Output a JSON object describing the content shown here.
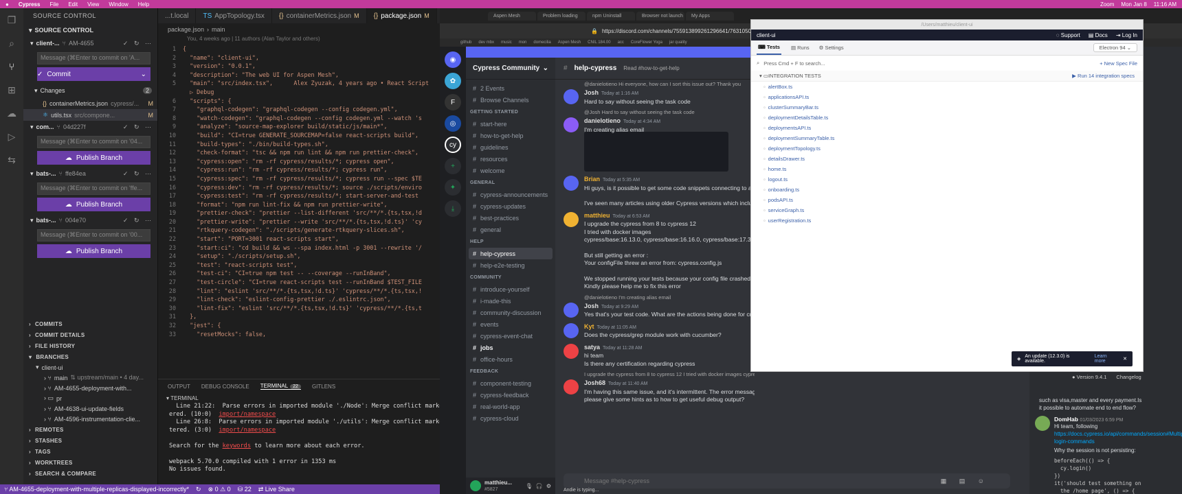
{
  "menubar": {
    "app": "Cypress",
    "items": [
      "File",
      "Edit",
      "View",
      "Window",
      "Help"
    ],
    "right_items": [
      "Zoom",
      "Mon Jan 8",
      "11:16 AM"
    ]
  },
  "vscode": {
    "title": "package.json — client-ui",
    "scm": {
      "header": "SOURCE CONTROL",
      "section": "SOURCE CONTROL",
      "repos": [
        {
          "name": "client-...",
          "branch": "AM-4655",
          "message_placeholder": "Message (⌘Enter to commit on 'A...",
          "button": "Commit"
        },
        {
          "name": "com...",
          "branch": "04d227f",
          "message_placeholder": "Message (⌘Enter to commit on '04...",
          "button": "Publish Branch"
        },
        {
          "name": "bats-...",
          "branch": "ffe84ea",
          "message_placeholder": "Message (⌘Enter to commit on 'ffe...",
          "button": "Publish Branch"
        },
        {
          "name": "bats-...",
          "branch": "004e70",
          "message_placeholder": "Message (⌘Enter to commit on '00...",
          "button": "Publish Branch"
        }
      ],
      "changes_label": "Changes",
      "changes_count": "2",
      "changed_files": [
        {
          "name": "containerMetrics.json",
          "path": "cypress/...",
          "status": "M"
        },
        {
          "name": "utils.tsx",
          "path": "src/compone...",
          "status": "M"
        }
      ],
      "bottom_sections": [
        "COMMITS",
        "COMMIT DETAILS",
        "FILE HISTORY",
        "BRANCHES"
      ],
      "branches_root": "client-ui",
      "branches": [
        {
          "name": "main",
          "info": "⇅ upstream/main • 4 day..."
        },
        {
          "name": "AM-4655-deployment-with...",
          "info": ""
        },
        {
          "name": "pr",
          "info": ""
        },
        {
          "name": "AM-4638-ui-update-fields",
          "info": ""
        },
        {
          "name": "AM-4596-instrumentation-clie...",
          "info": ""
        }
      ],
      "footer_sections": [
        "REMOTES",
        "STASHES",
        "TAGS",
        "WORKTREES",
        "SEARCH & COMPARE"
      ]
    },
    "tabs": [
      {
        "label": "...t.local",
        "modified": ""
      },
      {
        "label": "AppTopology.tsx",
        "modified": ""
      },
      {
        "label": "containerMetrics.json",
        "modified": "M"
      },
      {
        "label": "package.json",
        "modified": "M"
      }
    ],
    "breadcrumb": [
      "package.json",
      "main"
    ],
    "blame": "You, 4 weeks ago | 11 authors (Alan Taylor and others)",
    "code": [
      {
        "n": "1",
        "t": "{"
      },
      {
        "n": "2",
        "t": "  \"name\": \"client-ui\","
      },
      {
        "n": "3",
        "t": "  \"version\": \"0.0.1\","
      },
      {
        "n": "4",
        "t": "  \"description\": \"The web UI for Aspen Mesh\","
      },
      {
        "n": "5",
        "t": "  \"main\": \"src/index.tsx\",      Alex Zyuzak, 4 years ago • React Script"
      },
      {
        "n": "",
        "t": "  ▷ Debug"
      },
      {
        "n": "6",
        "t": "  \"scripts\": {"
      },
      {
        "n": "7",
        "t": "    \"graphql-codegen\": \"graphql-codegen --config codegen.yml\","
      },
      {
        "n": "8",
        "t": "    \"watch-codegen\": \"graphql-codegen --config codegen.yml --watch 's"
      },
      {
        "n": "9",
        "t": "    \"analyze\": \"source-map-explorer build/static/js/main*\","
      },
      {
        "n": "10",
        "t": "    \"build\": \"CI=true GENERATE_SOURCEMAP=false react-scripts build\","
      },
      {
        "n": "11",
        "t": "    \"build-types\": \"./bin/build-types.sh\","
      },
      {
        "n": "12",
        "t": "    \"check-format\": \"tsc && npm run lint && npm run prettier-check\","
      },
      {
        "n": "13",
        "t": "    \"cypress:open\": \"rm -rf cypress/results/*; cypress open\","
      },
      {
        "n": "14",
        "t": "    \"cypress:run\": \"rm -rf cypress/results/*; cypress run\","
      },
      {
        "n": "15",
        "t": "    \"cypress:spec\": \"rm -rf cypress/results/*; cypress run --spec $TE"
      },
      {
        "n": "16",
        "t": "    \"cypress:dev\": \"rm -rf cypress/results/*; source ./scripts/enviro"
      },
      {
        "n": "17",
        "t": "    \"cypress:test\": \"rm -rf cypress/results/*; start-server-and-test"
      },
      {
        "n": "18",
        "t": "    \"format\": \"npm run lint-fix && npm run prettier-write\","
      },
      {
        "n": "19",
        "t": "    \"prettier-check\": \"prettier --list-different 'src/**/*.{ts,tsx,!d"
      },
      {
        "n": "20",
        "t": "    \"prettier-write\": \"prettier --write 'src/**/*.{ts,tsx,!d.ts}' 'cy"
      },
      {
        "n": "21",
        "t": "    \"rtkquery-codegen\": \"./scripts/generate-rtkquery-slices.sh\","
      },
      {
        "n": "22",
        "t": "    \"start\": \"PORT=3001 react-scripts start\","
      },
      {
        "n": "23",
        "t": "    \"start:ci\": \"cd build && ws --spa index.html -p 3001 --rewrite '/"
      },
      {
        "n": "24",
        "t": "    \"setup\": \"./scripts/setup.sh\","
      },
      {
        "n": "25",
        "t": "    \"test\": \"react-scripts test\","
      },
      {
        "n": "26",
        "t": "    \"test-ci\": \"CI=true npm test -- --coverage --runInBand\","
      },
      {
        "n": "27",
        "t": "    \"test-circle\": \"CI=true react-scripts test --runInBand $TEST_FILE"
      },
      {
        "n": "28",
        "t": "    \"lint\": \"eslint 'src/**/*.{ts,tsx,!d.ts}' 'cypress/**/*.{ts,tsx,!"
      },
      {
        "n": "29",
        "t": "    \"lint-check\": \"eslint-config-prettier ./.eslintrc.json\","
      },
      {
        "n": "30",
        "t": "    \"lint-fix\": \"eslint 'src/**/*.{ts,tsx,!d.ts}' 'cypress/**/*.{ts,t"
      },
      {
        "n": "31",
        "t": "  },"
      },
      {
        "n": "32",
        "t": "  \"jest\": {"
      },
      {
        "n": "33",
        "t": "    \"resetMocks\": false,"
      }
    ],
    "panel_tabs": [
      "OUTPUT",
      "DEBUG CONSOLE",
      "TERMINAL",
      "GITLENS"
    ],
    "terminal_badge": "22",
    "terminal_header": "TERMINAL",
    "terminal": [
      {
        "a": "  Line 21:22:  Parse errors in imported module './Node': Merge conflict marker",
        "u": "",
        "b": ""
      },
      {
        "a": "ered. (10:0)  ",
        "u": "import/namespace",
        "b": ""
      },
      {
        "a": "  Line 26:8:  Parse errors in imported module './utils': Merge conflict marker",
        "u": "",
        "b": ""
      },
      {
        "a": "tered. (3:0)  ",
        "u": "import/namespace",
        "b": ""
      },
      {
        "a": "",
        "u": "",
        "b": ""
      },
      {
        "a": "Search for the ",
        "u": "keywords",
        "b": " to learn more about each error."
      },
      {
        "a": "",
        "u": "",
        "b": ""
      },
      {
        "a": "webpack 5.70.0 compiled with 1 error in 1353 ms",
        "u": "",
        "b": ""
      },
      {
        "a": "No issues found.",
        "u": "",
        "b": ""
      }
    ],
    "status": {
      "branch": "AM-4655-deployment-with-multiple-replicas-displayed-incorrectly*",
      "problems": "⊗ 0 ⚠ 0",
      "ports": "22",
      "live_share": "Live Share"
    }
  },
  "browser": {
    "tabs": [
      "Aspen Mesh",
      "Problem loading",
      "npm Uninstall",
      "Browser not launch",
      "My Apps"
    ],
    "url": "https://discord.com/channels/755913899261296641/763105090",
    "bookmarks": [
      "github",
      "dev mbx",
      "music",
      "mon",
      "domecilia",
      "Aspen Mesh",
      "CNIL 184.00",
      "acc",
      "CoreFlower Yoga",
      "jar quality"
    ]
  },
  "discord": {
    "banner": "Want to take full advantage of Discord w",
    "guild": "Cypress Community",
    "channels": [
      {
        "type": "ch",
        "label": "2 Events"
      },
      {
        "type": "ch",
        "label": "Browse Channels"
      },
      {
        "type": "cat",
        "label": "GETTING STARTED"
      },
      {
        "type": "ch",
        "label": "start-here"
      },
      {
        "type": "ch",
        "label": "how-to-get-help"
      },
      {
        "type": "ch",
        "label": "guidelines"
      },
      {
        "type": "ch",
        "label": "resources"
      },
      {
        "type": "ch",
        "label": "welcome"
      },
      {
        "type": "cat",
        "label": "GENERAL"
      },
      {
        "type": "ch",
        "label": "cypress-announcements"
      },
      {
        "type": "ch",
        "label": "cypress-updates"
      },
      {
        "type": "ch",
        "label": "best-practices"
      },
      {
        "type": "ch",
        "label": "general"
      },
      {
        "type": "cat",
        "label": "HELP"
      },
      {
        "type": "active",
        "label": "help-cypress"
      },
      {
        "type": "ch",
        "label": "help-e2e-testing"
      },
      {
        "type": "cat",
        "label": "COMMUNITY"
      },
      {
        "type": "ch",
        "label": "introduce-yourself"
      },
      {
        "type": "ch",
        "label": "i-made-this"
      },
      {
        "type": "ch",
        "label": "community-discussion"
      },
      {
        "type": "ch",
        "label": "events"
      },
      {
        "type": "ch",
        "label": "cypress-event-chat"
      },
      {
        "type": "bold",
        "label": "jobs"
      },
      {
        "type": "ch",
        "label": "office-hours"
      },
      {
        "type": "cat",
        "label": "FEEDBACK"
      },
      {
        "type": "ch",
        "label": "component-testing"
      },
      {
        "type": "ch",
        "label": "cypress-feedback"
      },
      {
        "type": "ch",
        "label": "real-world-app"
      },
      {
        "type": "ch",
        "label": "cypress-cloud"
      }
    ],
    "user": "matthieu...",
    "user_tag": "#5827",
    "channel_name": "help-cypress",
    "channel_topic": "Read #how-to-get-help",
    "messages": [
      {
        "reply": "@danielotieno Hi everyone, how can I sort this issue out? Thank you",
        "name": "Josh",
        "time": "Today at 1:16 AM",
        "color": "#e0e0e0",
        "lines": [
          "Hard to say without seeing the task code"
        ]
      },
      {
        "reply": "@Josh Hard to say without seeing the task code",
        "name": "danielotieno",
        "time": "Today at 4:34 AM",
        "color": "#e0e0e0",
        "lines": [
          "I'm creating alias email",
          "",
          "",
          "",
          "",
          ""
        ]
      },
      {
        "reply": "",
        "name": "Brian",
        "time": "Today at 5:35 AM",
        "color": "#f0b232",
        "lines": [
          "Hi guys, is it possible to get some code snippets connecting to a M",
          "",
          "I've seen many articles using older Cypress versions which include"
        ]
      },
      {
        "reply": "",
        "name": "matthieu",
        "time": "Today at 6:53 AM",
        "color": "#f0b232",
        "lines": [
          "I upgrade the cypress from 8 to cypress 12",
          "I tried with docker images",
          "cypress/base:16.13.0, cypress/base:16.16.0, cypress/base:17.3.0 , c",
          "",
          "But still getting an error :",
          "Your configFile threw an error from: cypress.config.js",
          "",
          "We stopped running your tests because your config file crashed.",
          "Kindly please help me to fix this error"
        ]
      },
      {
        "reply": "@danielotieno I'm creating alias email",
        "name": "Josh",
        "time": "Today at 9:29 AM",
        "color": "#e0e0e0",
        "lines": [
          "Yes that's your test code. What are the actions being done for cre"
        ]
      },
      {
        "reply": "",
        "name": "Kyt",
        "time": "Today at 11:05 AM",
        "color": "#f0b232",
        "lines": [
          "Does the cypress/grep module work with cucumber?"
        ]
      },
      {
        "reply": "",
        "name": "satya",
        "time": "Today at 11:28 AM",
        "color": "#e0e0e0",
        "lines": [
          "hi team",
          "Is there any certification regarding cypress"
        ]
      },
      {
        "reply": "I upgrade the cypress from 8 to cypress 12 I tried with docker images cypress/base:16.13.0, cypress/base:16.16.0, cypress/base:17.3.0 , cypress/base:16.17.0 , cypress/base:",
        "name": "Josh68",
        "time": "Today at 11:40 AM",
        "color": "#e0e0e0",
        "lines": [
          "I'm having this same issue, and it's intermittent. The error messaging isn't helpful, and the docs give an incorrect option for debugging config issues. Can someone",
          "please give some hints as to how to get useful debug output?"
        ]
      }
    ],
    "input_placeholder": "Message #help-cypress",
    "typing": "Andie is typing..."
  },
  "cypress": {
    "title": "/Users/matthieu/client-ui",
    "project": "client-ui",
    "header_links": [
      "Support",
      "Docs",
      "Log In"
    ],
    "nav": [
      "Tests",
      "Runs",
      "Settings"
    ],
    "browser_select": "Electron 94",
    "search_placeholder": "Press Cmd + F to search...",
    "new_spec": "+ New Spec File",
    "group": "INTEGRATION TESTS",
    "run_all": "▶ Run 14 integration specs",
    "specs": [
      "alertBox.ts",
      "applicationsAPI.ts",
      "clusterSummaryBar.ts",
      "deploymentDetailsTable.ts",
      "deploymentsAPI.ts",
      "deploymentSummaryTable.ts",
      "deploymentTopology.ts",
      "detailsDrawer.ts",
      "home.ts",
      "logout.ts",
      "onboarding.ts",
      "podsAPI.ts",
      "serviceGraph.ts",
      "userRegistration.ts"
    ],
    "update_text": "An update (12.3.0) is available.",
    "update_link": "Learn more",
    "version": "Version 9.4.1",
    "changelog": "Changelog"
  },
  "right_thread": {
    "name": "DomHab",
    "time": "01/03/2023 6:59 PM",
    "lines": [
      "Hi team, following"
    ],
    "link": "https://docs.cypress.io/api/commands/session#Multiple-login-commands",
    "lines2": [
      "Why the session is not persisting:"
    ],
    "code": [
      "beforeEach(() => {",
      "  cy.login()",
      "})",
      "",
      "it('should test something on",
      "  the /home page', () => {"
    ],
    "above": [
      "such as visa,master and every payment.Is",
      "it possible to automate end to end flow?"
    ],
    "sliver": [
      "ighthouse",
      "ypress-",
      "sting?!",
      "r based",
      "e use",
      "ocess",
      "yment.Is",
      "d flow?",
      "sting?!",
      "r based",
      "e use",
      "ocess",
      "yment.Is",
      "d flow?"
    ]
  }
}
